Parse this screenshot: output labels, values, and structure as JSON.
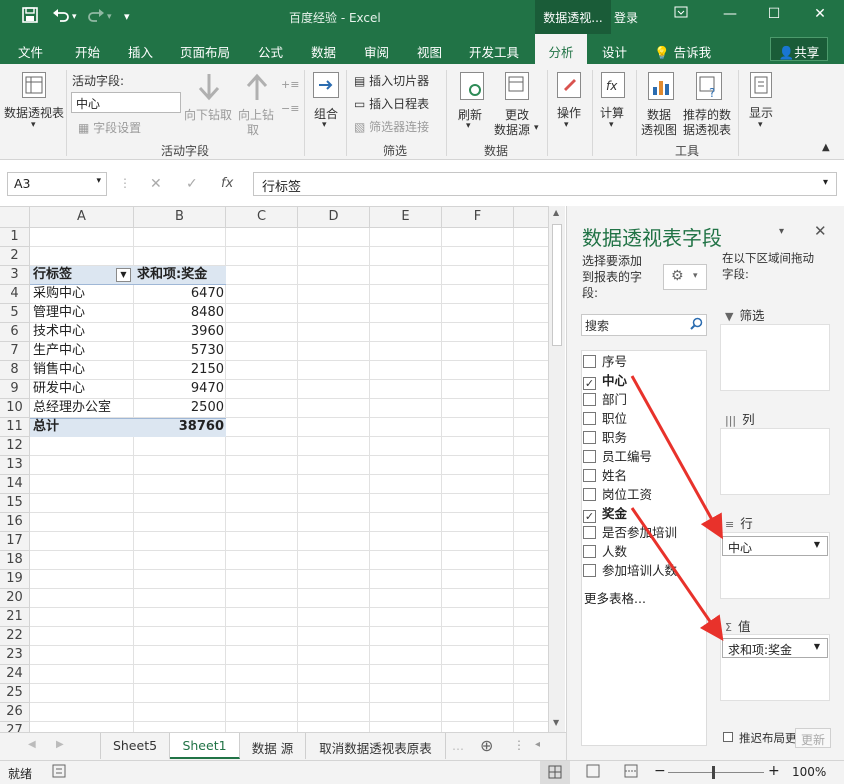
{
  "window": {
    "title": "百度经验 - Excel",
    "context_tab": "数据透视...",
    "login": "登录"
  },
  "tabs": [
    "文件",
    "开始",
    "插入",
    "页面布局",
    "公式",
    "数据",
    "审阅",
    "视图",
    "开发工具",
    "分析",
    "设计"
  ],
  "tell_me": "告诉我",
  "share": "共享",
  "ribbon": {
    "pivot_table": "数据透视表",
    "active_field_label": "活动字段:",
    "active_field_value": "中心",
    "field_settings": "字段设置",
    "drill_down": "向下钻取",
    "drill_up_1": "向上钻",
    "drill_up_2": "取",
    "group_active_field": "活动字段",
    "group_btn": "组合",
    "insert_slicer": "插入切片器",
    "insert_timeline": "插入日程表",
    "filter_connections": "筛选器连接",
    "group_filter": "筛选",
    "refresh": "刷新",
    "change_source_1": "更改",
    "change_source_2": "数据源",
    "group_data": "数据",
    "actions": "操作",
    "calculations": "计算",
    "pivot_chart_1": "数据",
    "pivot_chart_2": "透视图",
    "recommended_1": "推荐的数",
    "recommended_2": "据透视表",
    "group_tools": "工具",
    "show": "显示"
  },
  "formula_bar": {
    "name_box": "A3",
    "fx": "fx",
    "formula": "行标签"
  },
  "grid": {
    "columns": [
      "A",
      "B",
      "C",
      "D",
      "E",
      "F"
    ],
    "rows": [
      "1",
      "2",
      "3",
      "4",
      "5",
      "6",
      "7",
      "8",
      "9",
      "10",
      "11",
      "12",
      "13",
      "14",
      "15",
      "16",
      "17",
      "18",
      "19",
      "20",
      "21",
      "22",
      "23",
      "24",
      "25",
      "26",
      "27"
    ],
    "header_row_label": "行标签",
    "header_value": "求和项:奖金",
    "data": [
      {
        "label": "采购中心",
        "value": "6470"
      },
      {
        "label": "管理中心",
        "value": "8480"
      },
      {
        "label": "技术中心",
        "value": "3960"
      },
      {
        "label": "生产中心",
        "value": "5730"
      },
      {
        "label": "销售中心",
        "value": "2150"
      },
      {
        "label": "研发中心",
        "value": "9470"
      },
      {
        "label": "总经理办公室",
        "value": "2500"
      }
    ],
    "total_label": "总计",
    "total_value": "38760"
  },
  "sheets": [
    "Sheet5",
    "Sheet1",
    "数据 源",
    "取消数据透视表原表"
  ],
  "active_sheet": "Sheet1",
  "status": {
    "ready": "就绪",
    "zoom": "100%"
  },
  "pivot_pane": {
    "title": "数据透视表字段",
    "choose_text_1": "选择要添加",
    "choose_text_2": "到报表的字",
    "choose_text_3": "段:",
    "drag_text_1": "在以下区域间拖动",
    "drag_text_2": "字段:",
    "search_placeholder": "搜索",
    "fields": [
      {
        "name": "序号",
        "checked": false
      },
      {
        "name": "中心",
        "checked": true
      },
      {
        "name": "部门",
        "checked": false
      },
      {
        "name": "职位",
        "checked": false
      },
      {
        "name": "职务",
        "checked": false
      },
      {
        "name": "员工编号",
        "checked": false
      },
      {
        "name": "姓名",
        "checked": false
      },
      {
        "name": "岗位工资",
        "checked": false
      },
      {
        "name": "奖金",
        "checked": true
      },
      {
        "name": "是否参加培训",
        "checked": false
      },
      {
        "name": "人数",
        "checked": false
      },
      {
        "name": "参加培训人数",
        "checked": false
      }
    ],
    "more_tables": "更多表格...",
    "area_filters": "筛选",
    "area_columns": "列",
    "area_rows": "行",
    "area_values": "值",
    "rows_item": "中心",
    "values_item": "求和项:奖金",
    "defer_update": "推迟布局更新",
    "update": "更新"
  },
  "colors": {
    "brand": "#217346",
    "pivot_header": "#dce6f1",
    "arrow": "#e8322b"
  }
}
